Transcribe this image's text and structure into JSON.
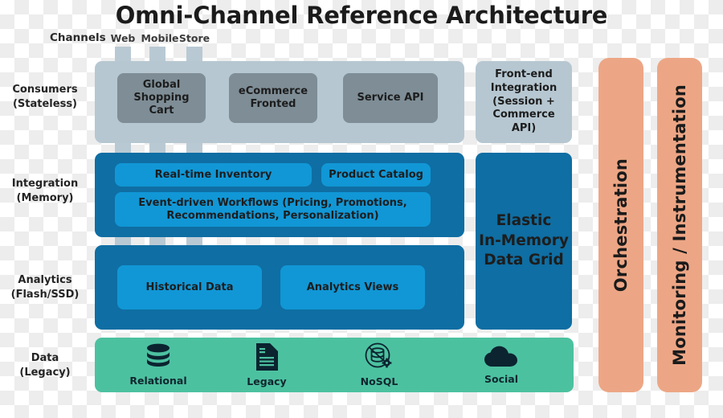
{
  "title": "Omni-Channel Reference Architecture",
  "channels": {
    "label": "Channels",
    "items": [
      {
        "label": "Web"
      },
      {
        "label": "Mobile"
      },
      {
        "label": "Store"
      }
    ]
  },
  "row_labels": [
    {
      "line1": "Consumers",
      "line2": "(Stateless)"
    },
    {
      "line1": "Integration",
      "line2": "(Memory)"
    },
    {
      "line1": "Analytics",
      "line2": "(Flash/SSD)"
    },
    {
      "line1": "Data",
      "line2": "(Legacy)"
    }
  ],
  "consumers": {
    "boxes": [
      {
        "label": "Global\nShopping Cart"
      },
      {
        "label": "eCommerce\nFronted"
      },
      {
        "label": "Service API"
      }
    ]
  },
  "frontend_integration": {
    "label": "Front-end\nIntegration\n(Session +\nCommerce API)"
  },
  "integration": {
    "boxes": [
      {
        "label": "Real-time Inventory"
      },
      {
        "label": "Product Catalog"
      },
      {
        "label": "Event-driven Workflows (Pricing, Promotions,\nRecommendations, Personalization)"
      }
    ]
  },
  "data_grid": {
    "label": "Elastic\nIn-Memory\nData Grid"
  },
  "analytics": {
    "boxes": [
      {
        "label": "Historical Data"
      },
      {
        "label": "Analytics Views"
      }
    ]
  },
  "data_layer": {
    "items": [
      {
        "label": "Relational",
        "icon": "database-icon"
      },
      {
        "label": "Legacy",
        "icon": "document-icon"
      },
      {
        "label": "NoSQL",
        "icon": "nosql-database-gear-icon"
      },
      {
        "label": "Social",
        "icon": "cloud-icon"
      }
    ]
  },
  "pillars": [
    {
      "label": "Orchestration"
    },
    {
      "label": "Monitoring / Instrumentation"
    }
  ],
  "colors": {
    "consumers_band": "#b6c7d1",
    "consumer_box": "#7e8d96",
    "blue_band": "#0f6ea3",
    "blue_box": "#1197d6",
    "green_band": "#4cc1a0",
    "pillar": "#eda685",
    "connector": "#b9c9d3",
    "text_dark": "#1b1b1b"
  }
}
